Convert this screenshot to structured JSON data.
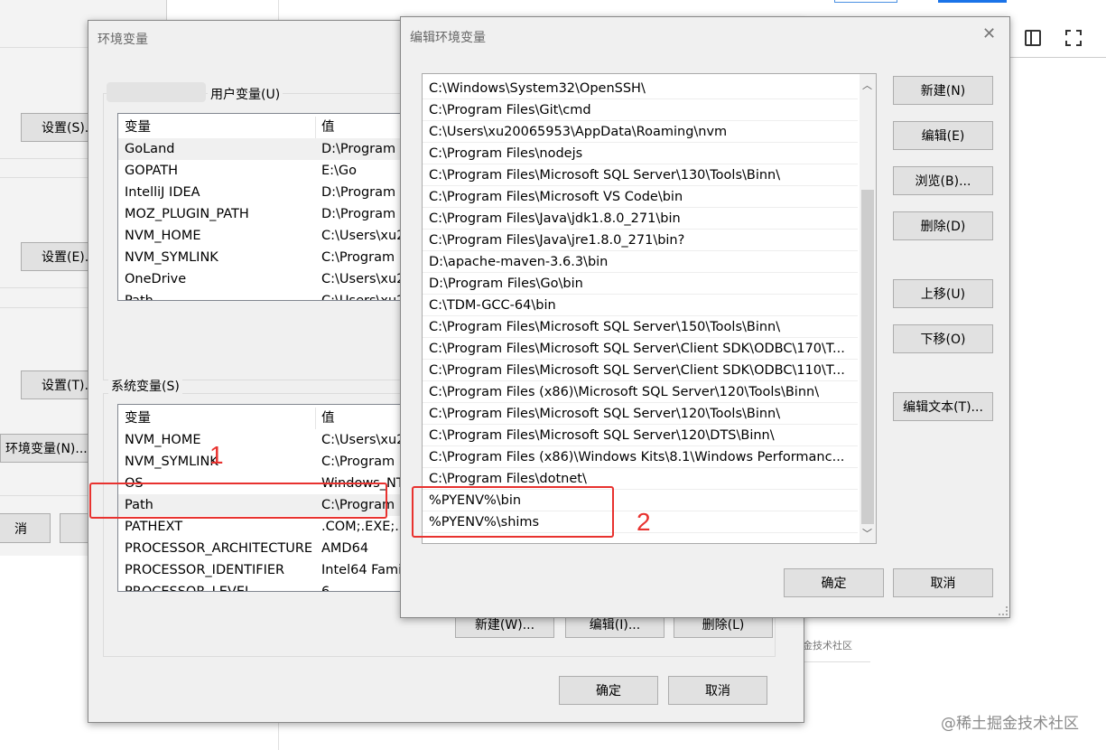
{
  "backdrop": {
    "buttons": [
      "设置(S)...",
      "设置(E)...",
      "设置(T)...",
      "环境变量(N)...",
      "消"
    ],
    "watermark_small": "金技术社区",
    "watermark": "@稀土掘金技术社区"
  },
  "env_dialog": {
    "title": "环境变量",
    "user_group_label": "用户变量(U)",
    "user_columns": [
      "变量",
      "值"
    ],
    "user_rows": [
      {
        "name": "GoLand",
        "value": "D:\\Program"
      },
      {
        "name": "GOPATH",
        "value": "E:\\Go"
      },
      {
        "name": "IntelliJ IDEA",
        "value": "D:\\Program"
      },
      {
        "name": "MOZ_PLUGIN_PATH",
        "value": "D:\\Program"
      },
      {
        "name": "NVM_HOME",
        "value": "C:\\Users\\xu2"
      },
      {
        "name": "NVM_SYMLINK",
        "value": "C:\\Program"
      },
      {
        "name": "OneDrive",
        "value": "C:\\Users\\xu2"
      },
      {
        "name": "Path",
        "value": "C:\\Users\\xu2"
      }
    ],
    "system_group_label": "系统变量(S)",
    "system_columns": [
      "变量",
      "值"
    ],
    "system_rows": [
      {
        "name": "NVM_HOME",
        "value": "C:\\Users\\xu2"
      },
      {
        "name": "NVM_SYMLINK",
        "value": "C:\\Program"
      },
      {
        "name": "OS",
        "value": "Windows_NT"
      },
      {
        "name": "Path",
        "value": "C:\\Program"
      },
      {
        "name": "PATHEXT",
        "value": ".COM;.EXE;.B"
      },
      {
        "name": "PROCESSOR_ARCHITECTURE",
        "value": "AMD64"
      },
      {
        "name": "PROCESSOR_IDENTIFIER",
        "value": "Intel64 Fami"
      },
      {
        "name": "PROCESSOR_LEVEL",
        "value": "6"
      }
    ],
    "system_buttons": {
      "new": "新建(W)...",
      "edit": "编辑(I)...",
      "delete": "删除(L)"
    },
    "ok": "确定",
    "cancel": "取消"
  },
  "edit_dialog": {
    "title": "编辑环境变量",
    "close_glyph": "✕",
    "entries": [
      "C:\\Windows\\System32\\OpenSSH\\",
      "C:\\Program Files\\Git\\cmd",
      "C:\\Users\\xu20065953\\AppData\\Roaming\\nvm",
      "C:\\Program Files\\nodejs",
      "C:\\Program Files\\Microsoft SQL Server\\130\\Tools\\Binn\\",
      "C:\\Program Files\\Microsoft VS Code\\bin",
      "C:\\Program Files\\Java\\jdk1.8.0_271\\bin",
      "C:\\Program Files\\Java\\jre1.8.0_271\\bin?",
      "D:\\apache-maven-3.6.3\\bin",
      "D:\\Program Files\\Go\\bin",
      "C:\\TDM-GCC-64\\bin",
      "C:\\Program Files\\Microsoft SQL Server\\150\\Tools\\Binn\\",
      "C:\\Program Files\\Microsoft SQL Server\\Client SDK\\ODBC\\170\\T...",
      "C:\\Program Files\\Microsoft SQL Server\\Client SDK\\ODBC\\110\\T...",
      "C:\\Program Files (x86)\\Microsoft SQL Server\\120\\Tools\\Binn\\",
      "C:\\Program Files\\Microsoft SQL Server\\120\\Tools\\Binn\\",
      "C:\\Program Files\\Microsoft SQL Server\\120\\DTS\\Binn\\",
      "C:\\Program Files (x86)\\Windows Kits\\8.1\\Windows Performanc...",
      "C:\\Program Files\\dotnet\\",
      "%PYENV%\\bin",
      "%PYENV%\\shims"
    ],
    "buttons": {
      "new": "新建(N)",
      "edit": "编辑(E)",
      "browse": "浏览(B)...",
      "delete": "删除(D)",
      "move_up": "上移(U)",
      "move_down": "下移(O)",
      "edit_text": "编辑文本(T)..."
    },
    "ok": "确定",
    "cancel": "取消"
  },
  "annotations": {
    "marker_1": "1",
    "marker_2": "2",
    "color": "#e8322f"
  }
}
